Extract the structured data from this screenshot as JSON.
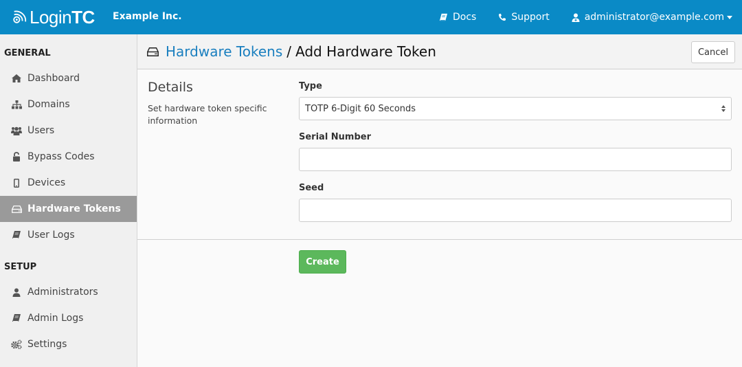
{
  "navbar": {
    "brand_light": "Login",
    "brand_bold": "TC",
    "org_name": "Example Inc.",
    "links": {
      "docs": "Docs",
      "support": "Support",
      "user": "administrator@example.com"
    },
    "color": "#0a8ac6"
  },
  "sidebar": {
    "sections": [
      {
        "heading": "GENERAL",
        "items": [
          {
            "label": "Dashboard",
            "icon": "home-icon"
          },
          {
            "label": "Domains",
            "icon": "sitemap-icon"
          },
          {
            "label": "Users",
            "icon": "users-icon"
          },
          {
            "label": "Bypass Codes",
            "icon": "unlock-icon"
          },
          {
            "label": "Devices",
            "icon": "mobile-icon"
          },
          {
            "label": "Hardware Tokens",
            "icon": "hdd-icon",
            "active": true
          },
          {
            "label": "User Logs",
            "icon": "book-icon"
          }
        ]
      },
      {
        "heading": "SETUP",
        "items": [
          {
            "label": "Administrators",
            "icon": "user-icon"
          },
          {
            "label": "Admin Logs",
            "icon": "book-icon"
          },
          {
            "label": "Settings",
            "icon": "gears-icon"
          }
        ]
      }
    ]
  },
  "header": {
    "breadcrumb_link": "Hardware Tokens",
    "separator": "/",
    "title": "Add Hardware Token",
    "cancel_label": "Cancel"
  },
  "form": {
    "section_title": "Details",
    "section_desc": "Set hardware token specific information",
    "type": {
      "label": "Type",
      "selected": "TOTP 6-Digit 60 Seconds"
    },
    "serial": {
      "label": "Serial Number",
      "value": ""
    },
    "seed": {
      "label": "Seed",
      "value": ""
    },
    "create_label": "Create"
  }
}
